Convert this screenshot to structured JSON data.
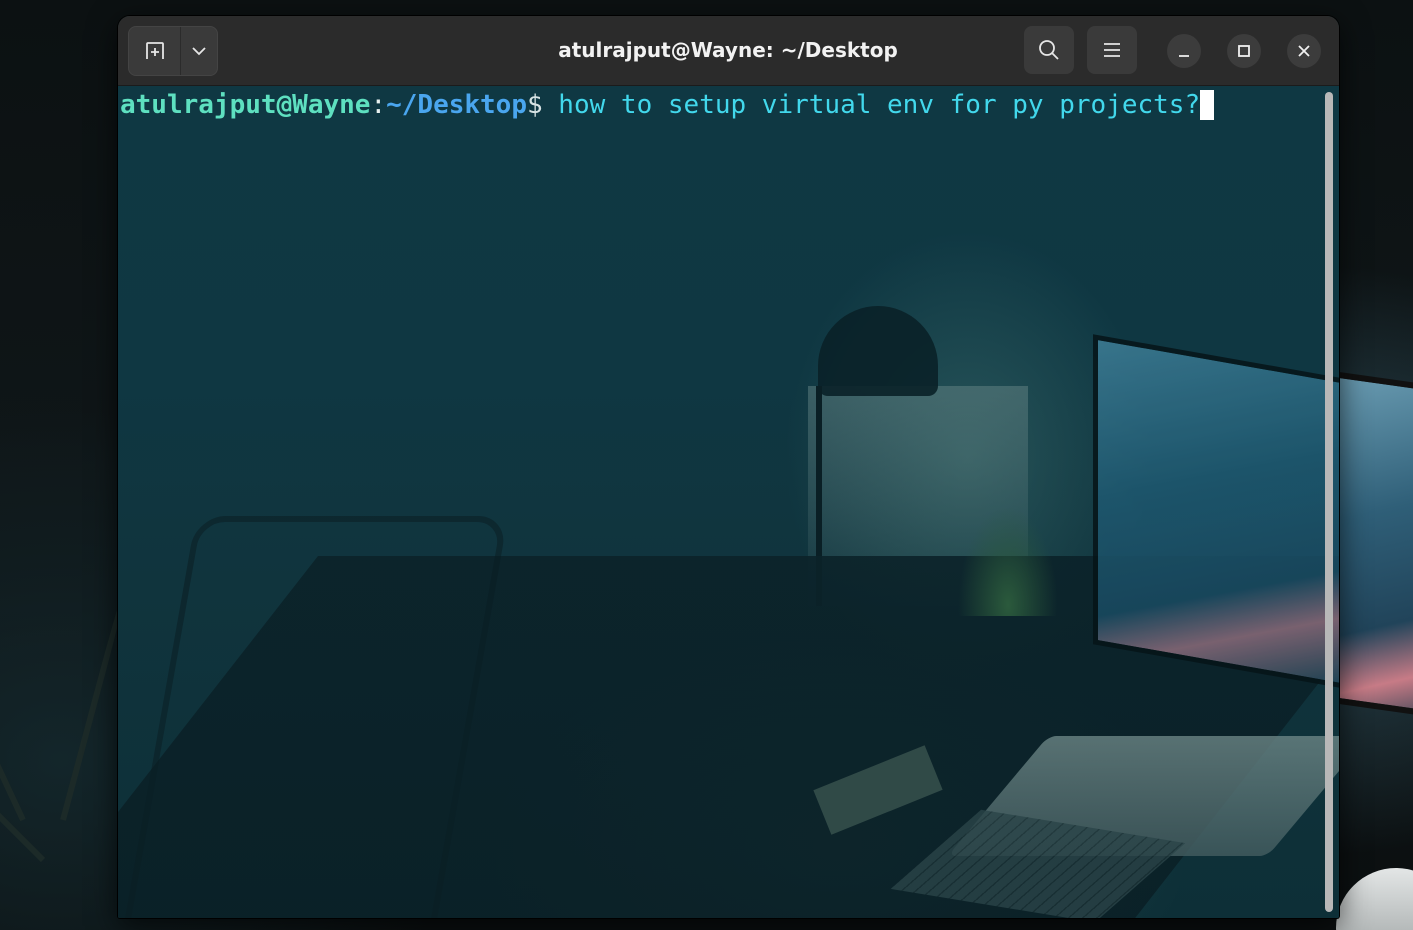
{
  "window": {
    "title": "atulrajput@Wayne: ~/Desktop"
  },
  "titlebar": {
    "buttons": [
      {
        "name": "new-tab-button",
        "icon": "new-tab-icon"
      },
      {
        "name": "tab-dropdown-button",
        "icon": "chevron-down-icon"
      },
      {
        "name": "search-button",
        "icon": "search-icon"
      },
      {
        "name": "menu-button",
        "icon": "hamburger-menu-icon"
      },
      {
        "name": "minimize-button",
        "icon": "minimize-icon"
      },
      {
        "name": "maximize-button",
        "icon": "maximize-icon"
      },
      {
        "name": "close-button",
        "icon": "close-icon"
      }
    ]
  },
  "terminal": {
    "prompt": {
      "user_host": "atulrajput@Wayne",
      "separator": ":",
      "cwd": "~/Desktop",
      "symbol": "$"
    },
    "input": " how to setup virtual env for py projects?"
  },
  "colors": {
    "user_host": "#5ee0c0",
    "cwd": "#4aa6ef",
    "command_text": "#42d8ec",
    "terminal_background": "#0f3843",
    "titlebar_background": "#2b2b2b"
  }
}
